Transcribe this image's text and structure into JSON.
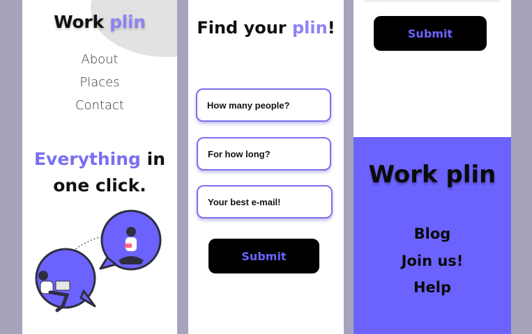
{
  "colors": {
    "accent": "#7a6ff0",
    "footer_bg": "#6c63ff",
    "button_bg": "#000000",
    "page_bg": "#a7a3bd"
  },
  "panel_home": {
    "brand": {
      "word1": "Work",
      "word2": "plin"
    },
    "nav": [
      "About",
      "Places",
      "Contact"
    ],
    "hero": {
      "accent": "Everything",
      "rest1": "in",
      "rest2": "one click."
    },
    "illustration": "chat-bubbles-people-illustration"
  },
  "panel_form": {
    "title": {
      "prefix": "Find your",
      "accent": "plin",
      "suffix": "!"
    },
    "fields": [
      "How many people?",
      "For how long?",
      "Your best e-mail!"
    ],
    "submit_label": "Submit"
  },
  "panel_footer": {
    "submit_label": "Submit",
    "brand": "Work plin",
    "links": [
      "Blog",
      "Join us!",
      "Help"
    ]
  }
}
